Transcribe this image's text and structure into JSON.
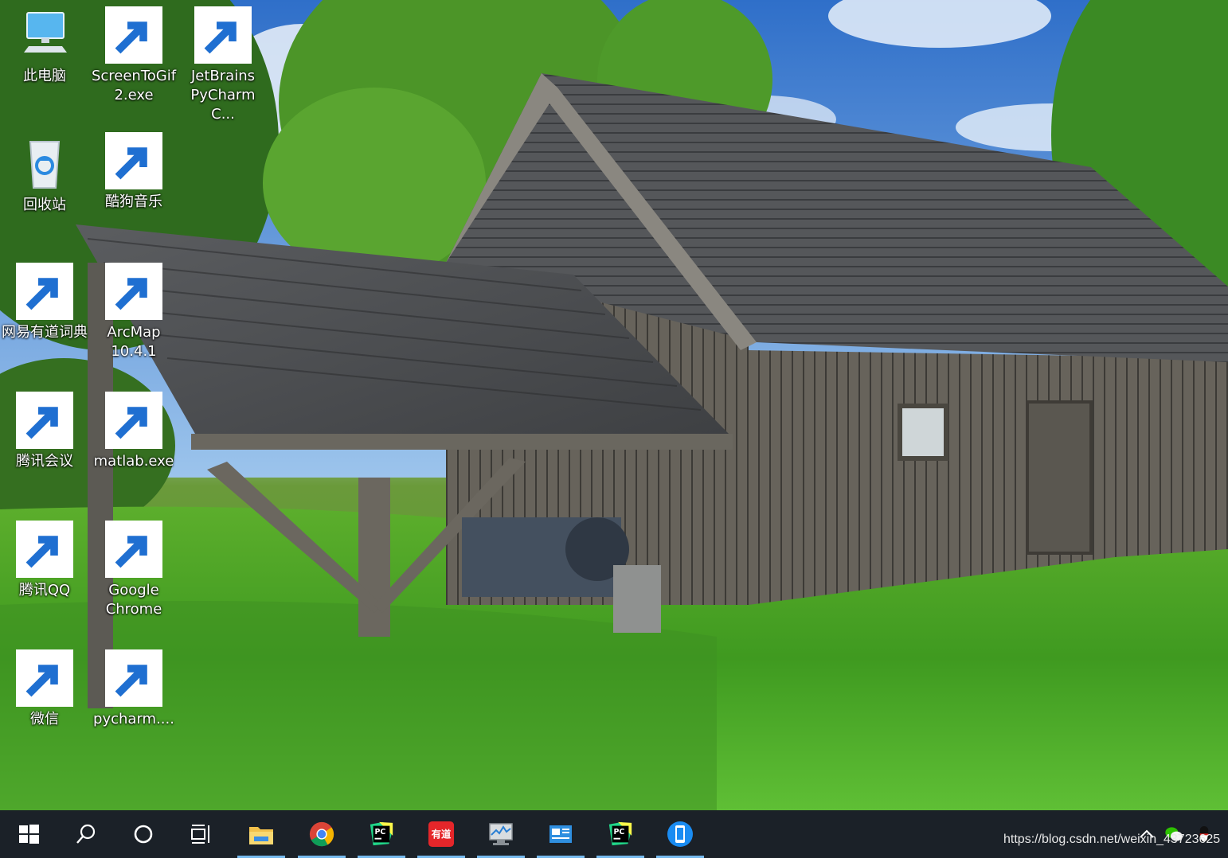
{
  "desktop": {
    "icons": [
      {
        "label": "此电脑",
        "icon": "this-pc-icon"
      },
      {
        "label": "ScreenToGif\n2.exe",
        "icon": "screentogif-icon"
      },
      {
        "label": "JetBrains\nPyCharm C...",
        "icon": "pycharm-icon"
      },
      {
        "label": "回收站",
        "icon": "recycle-bin-icon"
      },
      {
        "label": "酷狗音乐",
        "icon": "kugou-music-icon"
      },
      {
        "label": "网易有道词典",
        "icon": "youdao-dict-icon"
      },
      {
        "label": "ArcMap\n10.4.1",
        "icon": "arcmap-icon"
      },
      {
        "label": "腾讯会议",
        "icon": "tencent-meeting-icon"
      },
      {
        "label": "matlab.exe",
        "icon": "matlab-icon"
      },
      {
        "label": "腾讯QQ",
        "icon": "qq-icon"
      },
      {
        "label": "Google\nChrome",
        "icon": "chrome-icon"
      },
      {
        "label": "微信",
        "icon": "wechat-icon"
      },
      {
        "label": "pycharm....",
        "icon": "pycharm-icon"
      }
    ]
  },
  "taskbar": {
    "buttons": [
      {
        "icon": "windows-start-icon"
      },
      {
        "icon": "search-icon"
      },
      {
        "icon": "cortana-icon"
      },
      {
        "icon": "task-view-icon"
      },
      {
        "icon": "file-explorer-icon"
      },
      {
        "icon": "chrome-icon"
      },
      {
        "icon": "pycharm-icon"
      },
      {
        "icon": "youdao-dict-icon"
      },
      {
        "icon": "resource-monitor-icon"
      },
      {
        "icon": "presentation-icon"
      },
      {
        "icon": "pycharm-icon"
      },
      {
        "icon": "phone-link-icon"
      }
    ],
    "tray": {
      "icons": [
        "chevron-up-icon",
        "wechat-icon",
        "qq-icon"
      ],
      "watermark": "https://blog.csdn.net/weixin_43723625"
    }
  },
  "colors": {
    "taskbar_bg": "#1b2128",
    "running_indicator": "#76b9ed",
    "pycharm_green": "#21d789",
    "youdao_red": "#e5262a",
    "kugou_blue": "#1b85f0",
    "tencent_meeting_blue": "#0f6cfa"
  }
}
